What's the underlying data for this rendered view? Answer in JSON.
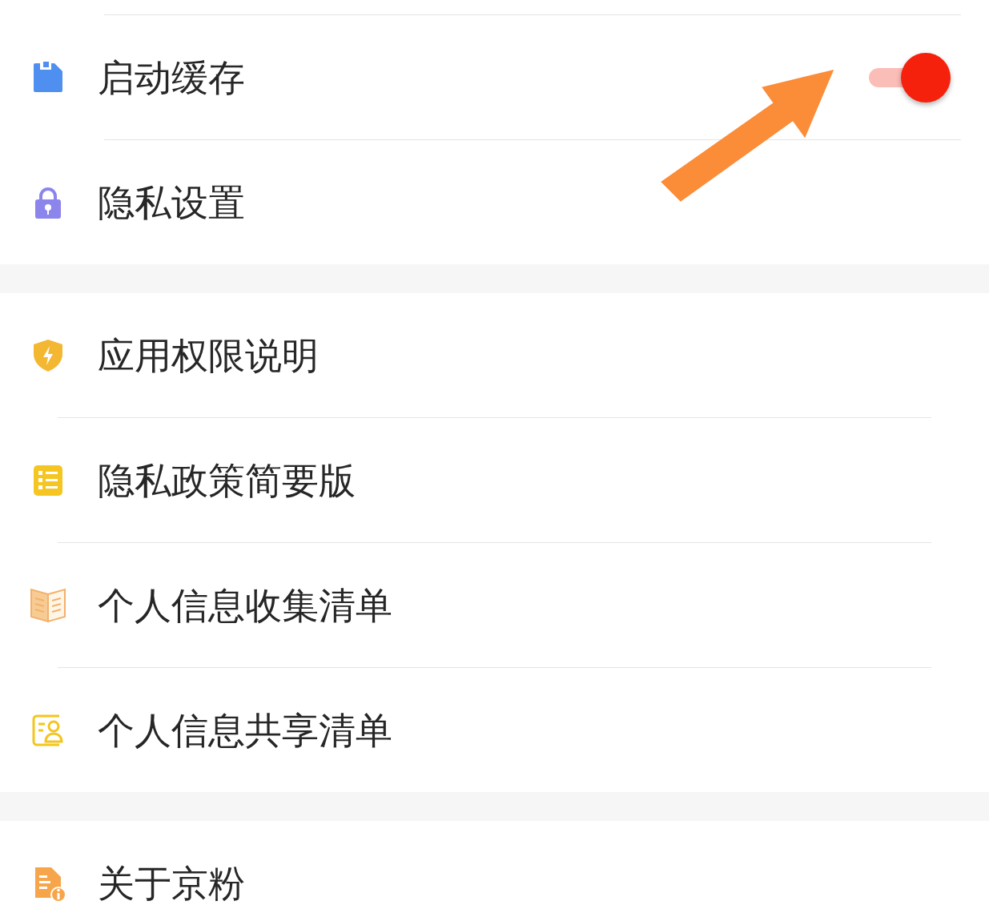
{
  "groups": [
    {
      "items": [
        {
          "label": "启动缓存",
          "kind": "toggle",
          "on": true
        },
        {
          "label": "隐私设置",
          "kind": "link"
        }
      ]
    },
    {
      "items": [
        {
          "label": "应用权限说明",
          "kind": "link"
        },
        {
          "label": "隐私政策简要版",
          "kind": "link"
        },
        {
          "label": "个人信息收集清单",
          "kind": "link"
        },
        {
          "label": "个人信息共享清单",
          "kind": "link"
        }
      ]
    },
    {
      "items": [
        {
          "label": "关于京粉",
          "kind": "link"
        }
      ]
    }
  ]
}
